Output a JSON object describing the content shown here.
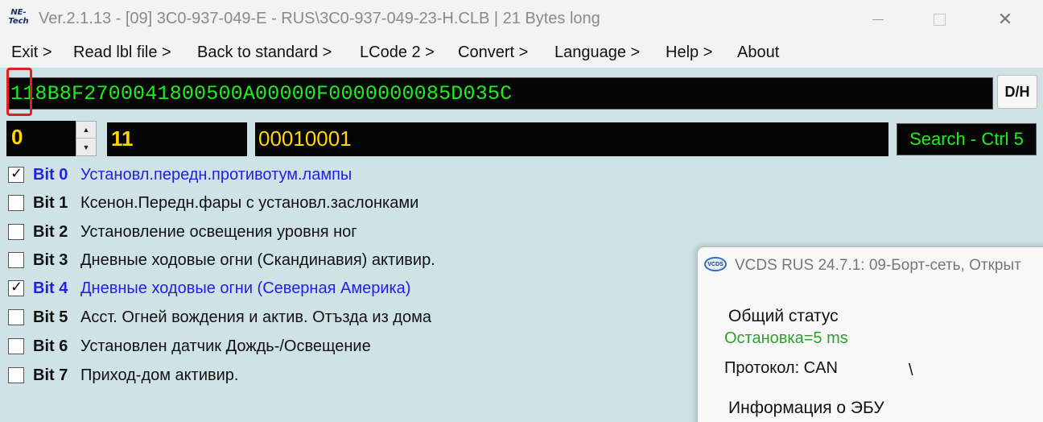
{
  "window": {
    "logo": "NE-Tech",
    "title": "Ver.2.1.13 - [09] 3C0-937-049-E - RUS\\3C0-937-049-23-H.CLB | 21 Bytes long",
    "close_glyph": "✕"
  },
  "menu": [
    {
      "label": "Exit >"
    },
    {
      "label": "Read lbl file >"
    },
    {
      "label": "Back to standard >"
    },
    {
      "label": "LCode 2 >"
    },
    {
      "label": "Convert >"
    },
    {
      "label": "Language >"
    },
    {
      "label": "Help >"
    },
    {
      "label": "About"
    }
  ],
  "coding": {
    "hex_string": "118B8F2700041800500A00000F0000000085D035C",
    "dh_label": "D/H",
    "byte_index": "0",
    "byte_hex": "11",
    "byte_binary": "00010001",
    "search_label": "Search - Ctrl 5"
  },
  "bits": [
    {
      "num": "Bit 0",
      "label": "Установл.передн.противотум.лампы",
      "checked": true
    },
    {
      "num": "Bit 1",
      "label": "Ксенон.Передн.фары с установл.заслонками",
      "checked": false
    },
    {
      "num": "Bit 2",
      "label": "Установление освещения уровня ног",
      "checked": false
    },
    {
      "num": "Bit 3",
      "label": "Дневные ходовые огни (Скандинавия) активир.",
      "checked": false
    },
    {
      "num": "Bit 4",
      "label": "Дневные ходовые огни (Северная Америка)",
      "checked": true
    },
    {
      "num": "Bit 5",
      "label": "Асст. Огней вождения и актив. Отъзда из дома",
      "checked": false
    },
    {
      "num": "Bit 6",
      "label": "Установлен датчик Дождь-/Освещение",
      "checked": false
    },
    {
      "num": "Bit 7",
      "label": "Приход-дом активир.",
      "checked": false
    }
  ],
  "vcds": {
    "icon_text": "VCDS",
    "title": "VCDS RUS 24.7.1: 09-Борт-сеть,  Открыт",
    "status_heading": "Общий статус",
    "status_value": "Остановка=5 ms",
    "protocol": "Протокол: CAN",
    "slash": "\\",
    "ecu_info": "Информация о ЭБУ"
  },
  "colors": {
    "panel_bg": "#cfe3e6",
    "field_bg": "#050505",
    "hex_text": "#1cf01c",
    "value_text": "#ffd800",
    "active_bit": "#2121e6",
    "status_green": "#2f9e2f"
  }
}
